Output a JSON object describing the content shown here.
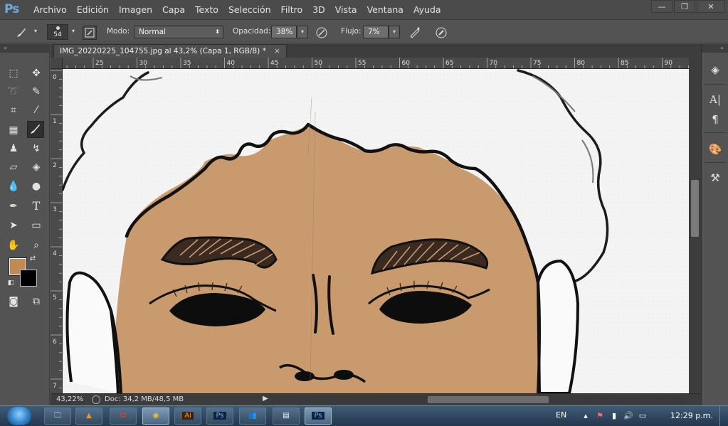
{
  "app": {
    "logo": "Ps"
  },
  "menu": [
    "Archivo",
    "Edición",
    "Imagen",
    "Capa",
    "Texto",
    "Selección",
    "Filtro",
    "3D",
    "Vista",
    "Ventana",
    "Ayuda"
  ],
  "window_controls": {
    "minimize": "—",
    "restore": "❐",
    "close": "✕"
  },
  "options": {
    "brush_size": "54",
    "mode_label": "Modo:",
    "mode_value": "Normal",
    "opacity_label": "Opacidad:",
    "opacity_value": "38%",
    "flow_label": "Flujo:",
    "flow_value": "7%"
  },
  "document": {
    "tab_title": "IMG_20220225_104755.jpg al 43,2% (Capa 1, RGB/8) *",
    "tab_close": "×",
    "zoom": "43,22%",
    "doc_info": "Doc: 34,2 MB/48,5 MB"
  },
  "ruler": {
    "top_labels": [
      "25",
      "30",
      "35",
      "40",
      "45",
      "50",
      "55",
      "60",
      "65",
      "70",
      "75",
      "80",
      "85",
      "90"
    ],
    "left_labels": [
      "0",
      "1",
      "2",
      "3",
      "4",
      "5",
      "6",
      "7"
    ]
  },
  "colors": {
    "foreground": "#c18a55",
    "background": "#000000",
    "skin": "#c99a6d"
  },
  "taskbar": {
    "apps": [
      "explorer-icon",
      "vlc-icon",
      "opera-icon",
      "chrome-icon",
      "illustrator-icon",
      "photoshop-icon",
      "users-icon",
      "notepad-icon",
      "photoshop-active-icon"
    ],
    "illustrator": "Ai",
    "photoshop": "Ps",
    "language": "EN",
    "clock": "12:29 p.m."
  }
}
